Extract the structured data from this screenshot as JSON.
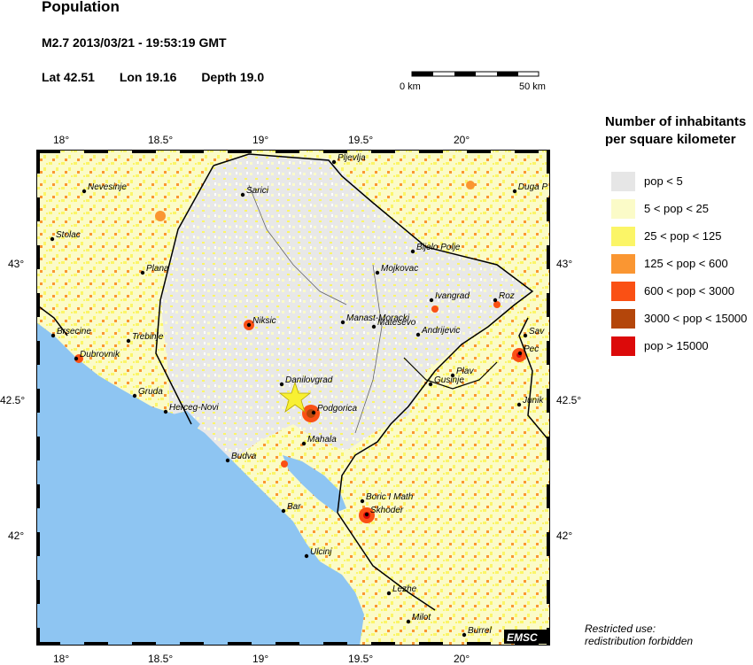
{
  "header": {
    "title": "Population",
    "event": "M2.7  2013/03/21 - 19:53:19 GMT",
    "lat": "Lat 42.51",
    "lon": "Lon  19.16",
    "depth": "Depth  19.0"
  },
  "scale_bar": {
    "left_label": "0 km",
    "right_label": "50 km"
  },
  "legend": {
    "title_line1": "Number of inhabitants",
    "title_line2": "per square kilometer",
    "items": [
      {
        "label": "pop < 5",
        "color": "#e6e6e6"
      },
      {
        "label": "5 < pop < 25",
        "color": "#fbfbc8"
      },
      {
        "label": "25 < pop < 125",
        "color": "#fbf567"
      },
      {
        "label": "125 < pop < 600",
        "color": "#fa9632"
      },
      {
        "label": "600 < pop < 3000",
        "color": "#fa5014"
      },
      {
        "label": "3000 < pop < 15000",
        "color": "#b4460a"
      },
      {
        "label": "pop > 15000",
        "color": "#dc0a0a"
      }
    ]
  },
  "axes": {
    "lon_ticks": [
      "18°",
      "18.5°",
      "19°",
      "19.5°",
      "20°"
    ],
    "lat_ticks": [
      "43°",
      "42.5°",
      "42°"
    ]
  },
  "colors": {
    "sea": "#8ec5f2",
    "land": "#e8e8e8",
    "star": "#f8f032"
  },
  "cities": [
    {
      "name": "Pljevlja"
    },
    {
      "name": "Sarici"
    },
    {
      "name": "Nevesinje"
    },
    {
      "name": "Duga P"
    },
    {
      "name": "Stolac"
    },
    {
      "name": "Bijelo Polje"
    },
    {
      "name": "Plana"
    },
    {
      "name": "Mojkovac"
    },
    {
      "name": "Ivangrad"
    },
    {
      "name": "Roz"
    },
    {
      "name": "Niksic"
    },
    {
      "name": "Manast-Moracki"
    },
    {
      "name": "Matesevo"
    },
    {
      "name": "Andrijevic"
    },
    {
      "name": "Sav"
    },
    {
      "name": "Brsecine"
    },
    {
      "name": "Trebinje"
    },
    {
      "name": "Dubrovnik"
    },
    {
      "name": "Pec"
    },
    {
      "name": "Plav"
    },
    {
      "name": "Danilovgrad"
    },
    {
      "name": "Gusinje"
    },
    {
      "name": "Gruda"
    },
    {
      "name": "Junik"
    },
    {
      "name": "Podgorica"
    },
    {
      "name": "Herceg-Novi"
    },
    {
      "name": "Mahala"
    },
    {
      "name": "Budva"
    },
    {
      "name": "Boric I Math"
    },
    {
      "name": "Skhoder"
    },
    {
      "name": "Bar"
    },
    {
      "name": "Ulcinj"
    },
    {
      "name": "Lezhe"
    },
    {
      "name": "Milot"
    },
    {
      "name": "Burrel"
    }
  ],
  "footer": {
    "emsc": "EMSC",
    "note_line1": "Restricted use:",
    "note_line2": "redistribution forbidden"
  }
}
